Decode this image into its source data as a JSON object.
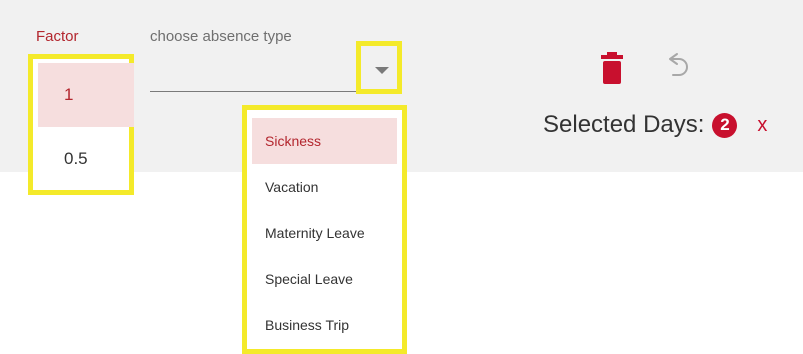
{
  "colors": {
    "accent": "#b3262e",
    "selected_bg": "#f6dede",
    "highlight": "#f4ea2a",
    "badge": "#c8102e"
  },
  "factor": {
    "label": "Factor",
    "options": [
      {
        "label": "1",
        "selected": true
      },
      {
        "label": "0.5",
        "selected": false
      }
    ]
  },
  "absence": {
    "placeholder": "choose absence type",
    "options": [
      {
        "label": "Sickness",
        "selected": true
      },
      {
        "label": "Vacation",
        "selected": false
      },
      {
        "label": "Maternity Leave",
        "selected": false
      },
      {
        "label": "Special Leave",
        "selected": false
      },
      {
        "label": "Business Trip",
        "selected": false
      }
    ]
  },
  "toolbar": {
    "delete_icon": "trash-icon",
    "undo_icon": "undo-icon"
  },
  "selection": {
    "label": "Selected Days:",
    "count": "2",
    "clear_label": "x"
  }
}
